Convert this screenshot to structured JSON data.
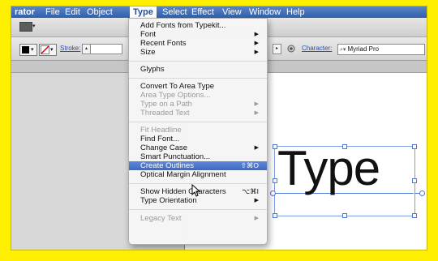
{
  "menubar": {
    "app": "rator",
    "items": [
      "File",
      "Edit",
      "Object",
      "Type",
      "Select",
      "Effect",
      "View",
      "Window",
      "Help"
    ],
    "active": "Type"
  },
  "control_bar": {
    "stroke_label": "Stroke:",
    "character_label": "Character:",
    "font_value": "Myriad Pro"
  },
  "type_menu": {
    "items": [
      {
        "label": "Add Fonts from Typekit...",
        "state": "enabled"
      },
      {
        "label": "Font",
        "submenu": true
      },
      {
        "label": "Recent Fonts",
        "submenu": true
      },
      {
        "label": "Size",
        "submenu": true
      },
      {
        "label": "Glyphs"
      },
      {
        "label": "Convert To Area Type"
      },
      {
        "label": "Area Type Options...",
        "disabled": true
      },
      {
        "label": "Type on a Path",
        "submenu": true,
        "disabled": true
      },
      {
        "label": "Threaded Text",
        "submenu": true,
        "disabled": true
      },
      {
        "label": "Fit Headline",
        "disabled": true
      },
      {
        "label": "Find Font..."
      },
      {
        "label": "Change Case",
        "submenu": true
      },
      {
        "label": "Smart Punctuation..."
      },
      {
        "label": "Create Outlines",
        "shortcut": "⇧⌘O",
        "highlighted": true
      },
      {
        "label": "Optical Margin Alignment"
      },
      {
        "label": "Show Hidden Characters",
        "shortcut": "⌥⌘I"
      },
      {
        "label": "Type Orientation",
        "submenu": true
      },
      {
        "label": "Legacy Text",
        "submenu": true,
        "disabled": true
      }
    ]
  },
  "document": {
    "sample_text": "Type"
  },
  "colors": {
    "menu_highlight": "#3c68c4",
    "background": "#ffef00"
  }
}
